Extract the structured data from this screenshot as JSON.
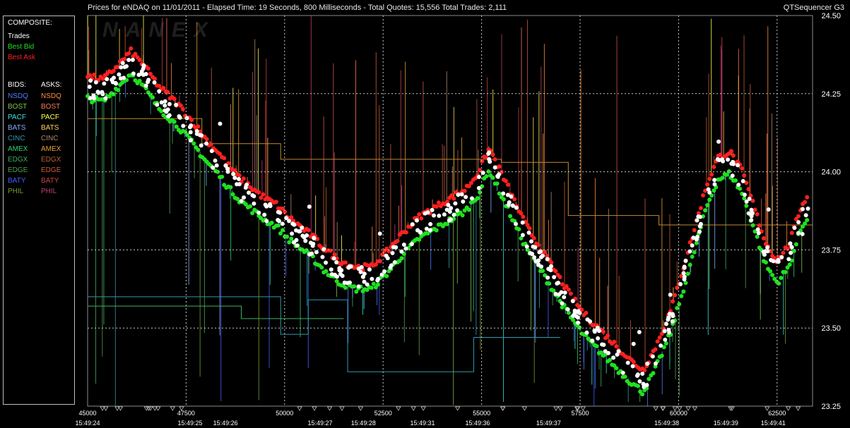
{
  "header": {
    "title": "Prices for  eNDAQ  on  11/01/2011  -  Elapsed Time: 19 Seconds, 800 Milliseconds  -  Total Quotes: 15,556  Total Trades: 2,111",
    "product": "QTSequencer G3"
  },
  "watermark": "NANEX",
  "legend": {
    "composite_label": "COMPOSITE:",
    "trades": "Trades",
    "best_bid": "Best Bid",
    "best_ask": "Best Ask",
    "bids_label": "BIDS:",
    "asks_label": "ASKS:",
    "exchanges": [
      {
        "name": "NSDQ",
        "bid_color": "#4f7fff",
        "ask_color": "#ff8c3a"
      },
      {
        "name": "BOST",
        "bid_color": "#80c050",
        "ask_color": "#ff7a55"
      },
      {
        "name": "PACF",
        "bid_color": "#40e0e0",
        "ask_color": "#ffff50"
      },
      {
        "name": "BATS",
        "bid_color": "#88aaff",
        "ask_color": "#ffd35a"
      },
      {
        "name": "CINC",
        "bid_color": "#2f9ab0",
        "ask_color": "#b08a6a"
      },
      {
        "name": "AMEX",
        "bid_color": "#30d070",
        "ask_color": "#e8a030"
      },
      {
        "name": "EDGX",
        "bid_color": "#40b060",
        "ask_color": "#c06030"
      },
      {
        "name": "EDGE",
        "bid_color": "#50a050",
        "ask_color": "#d05a3a"
      },
      {
        "name": "BATY",
        "bid_color": "#4060ff",
        "ask_color": "#d04040"
      },
      {
        "name": "PHIL",
        "bid_color": "#70a030",
        "ask_color": "#c04070"
      }
    ],
    "colors": {
      "trades": "#ffffff",
      "best_bid": "#20e020",
      "best_ask": "#ff2020"
    }
  },
  "chart_data": {
    "type": "scatter",
    "ylim": [
      23.25,
      24.5
    ],
    "xlim": [
      45000,
      63400
    ],
    "y_ticks": [
      "24.50",
      "24.25",
      "24.00",
      "23.75",
      "23.50",
      "23.25"
    ],
    "x_ticks": [
      "45000",
      "47500",
      "50000",
      "52500",
      "55000",
      "57500",
      "60000",
      "62500"
    ],
    "time_labels": [
      {
        "seq": 45000,
        "label": "15:49:24"
      },
      {
        "seq": 47600,
        "label": "15:49:25"
      },
      {
        "seq": 48500,
        "label": "15:49:26"
      },
      {
        "seq": 50900,
        "label": "15:49:27"
      },
      {
        "seq": 52000,
        "label": "15:49:28"
      },
      {
        "seq": 53500,
        "label": "15:49:31"
      },
      {
        "seq": 54900,
        "label": "15:49:36"
      },
      {
        "seq": 56700,
        "label": "15:49:37"
      },
      {
        "seq": 59700,
        "label": "15:49:38"
      },
      {
        "seq": 61200,
        "label": "15:49:39"
      },
      {
        "seq": 62400,
        "label": "15:49:41"
      }
    ],
    "grid": true,
    "price_path": [
      [
        45000,
        24.27
      ],
      [
        45400,
        24.26
      ],
      [
        45800,
        24.31
      ],
      [
        46100,
        24.35
      ],
      [
        46400,
        24.31
      ],
      [
        46800,
        24.24
      ],
      [
        47300,
        24.18
      ],
      [
        47700,
        24.12
      ],
      [
        48000,
        24.07
      ],
      [
        48300,
        24.03
      ],
      [
        48600,
        23.98
      ],
      [
        48900,
        23.94
      ],
      [
        49200,
        23.91
      ],
      [
        49500,
        23.88
      ],
      [
        49800,
        23.86
      ],
      [
        50100,
        23.82
      ],
      [
        50400,
        23.79
      ],
      [
        50700,
        23.76
      ],
      [
        51000,
        23.72
      ],
      [
        51400,
        23.68
      ],
      [
        51800,
        23.66
      ],
      [
        52200,
        23.66
      ],
      [
        52600,
        23.71
      ],
      [
        53000,
        23.77
      ],
      [
        53400,
        23.82
      ],
      [
        53800,
        23.85
      ],
      [
        54200,
        23.88
      ],
      [
        54600,
        23.91
      ],
      [
        54900,
        23.96
      ],
      [
        55200,
        24.04
      ],
      [
        55500,
        23.96
      ],
      [
        55800,
        23.88
      ],
      [
        56100,
        23.8
      ],
      [
        56400,
        23.74
      ],
      [
        56800,
        23.66
      ],
      [
        57200,
        23.58
      ],
      [
        57600,
        23.51
      ],
      [
        58000,
        23.46
      ],
      [
        58400,
        23.41
      ],
      [
        58800,
        23.36
      ],
      [
        59100,
        23.33
      ],
      [
        59400,
        23.4
      ],
      [
        59800,
        23.52
      ],
      [
        60100,
        23.65
      ],
      [
        60400,
        23.78
      ],
      [
        60700,
        23.92
      ],
      [
        61000,
        24.01
      ],
      [
        61300,
        24.03
      ],
      [
        61600,
        23.97
      ],
      [
        61900,
        23.86
      ],
      [
        62200,
        23.74
      ],
      [
        62500,
        23.68
      ],
      [
        62800,
        23.73
      ],
      [
        63100,
        23.85
      ],
      [
        63350,
        23.91
      ]
    ],
    "spread": 0.035
  }
}
